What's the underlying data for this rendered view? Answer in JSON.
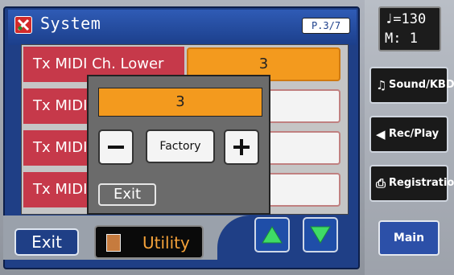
{
  "header": {
    "title": "System",
    "page": "P.3/7"
  },
  "rows": [
    {
      "label": "Tx MIDI Ch. Lower",
      "value": "3"
    },
    {
      "label": "Tx MIDI",
      "value": ""
    },
    {
      "label": "Tx MIDI",
      "value": ""
    },
    {
      "label": "Tx MIDI",
      "value": ""
    }
  ],
  "popup": {
    "value": "3",
    "minus_icon": "minus-icon",
    "factory_label": "Factory",
    "plus_icon": "plus-icon",
    "exit_label": "Exit"
  },
  "footer": {
    "exit_label": "Exit",
    "utility_label": "Utility",
    "up_icon": "up-arrow-icon",
    "down_icon": "down-arrow-icon"
  },
  "sidebar": {
    "tempo_line1": "♩=130",
    "tempo_line2": "M:  1",
    "buttons": [
      {
        "icon": "♫",
        "label": "Sound/KBD"
      },
      {
        "icon": "◀",
        "label": "Rec/Play"
      },
      {
        "icon": "⎙",
        "label": "Registration"
      }
    ],
    "main_label": "Main"
  },
  "colors": {
    "panel_blue": "#1f3f86",
    "label_red": "#c6394a",
    "selected_orange": "#f39a1e",
    "arrow_green": "#3fdc66"
  }
}
